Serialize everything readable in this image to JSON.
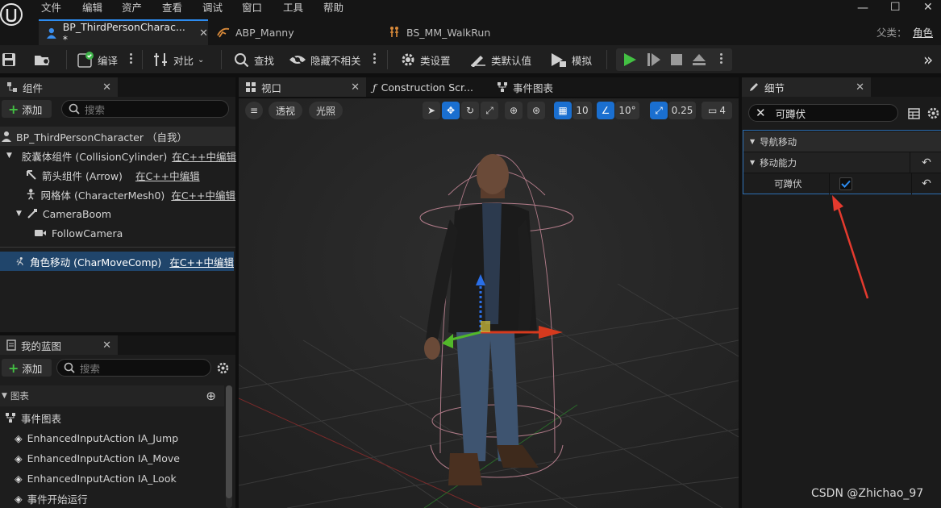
{
  "menu": [
    "文件",
    "编辑",
    "资产",
    "查看",
    "调试",
    "窗口",
    "工具",
    "帮助"
  ],
  "window_controls": {
    "minimize": "—",
    "maximize": "☐",
    "close": "✕"
  },
  "tabs": [
    {
      "label": "BP_ThirdPersonCharac... *",
      "close": "✕"
    },
    {
      "label": "ABP_Manny"
    },
    {
      "label": "BS_MM_WalkRun"
    }
  ],
  "parent": {
    "label": "父类：",
    "value": "角色"
  },
  "toolbar": {
    "compile": "编译",
    "diff": "对比",
    "find": "查找",
    "hide_unrelated": "隐藏不相关",
    "class_settings": "类设置",
    "class_defaults": "类默认值",
    "simulate": "模拟"
  },
  "components_panel": {
    "title": "组件",
    "close": "✕",
    "add": "添加",
    "search_placeholder": "搜索",
    "items": [
      {
        "label": "BP_ThirdPersonCharacter （自我）",
        "edit": ""
      },
      {
        "label": "胶囊体组件 (CollisionCylinder)",
        "edit": "在C++中编辑"
      },
      {
        "label": "箭头组件 (Arrow)",
        "edit": "在C++中编辑"
      },
      {
        "label": "网格体 (CharacterMesh0)",
        "edit": "在C++中编辑"
      },
      {
        "label": "CameraBoom",
        "edit": ""
      },
      {
        "label": "FollowCamera",
        "edit": ""
      },
      {
        "label": "角色移动 (CharMoveComp)",
        "edit": "在C++中编辑"
      }
    ]
  },
  "blueprint_panel": {
    "title": "我的蓝图",
    "close": "✕",
    "add": "添加",
    "search_placeholder": "搜索",
    "section": "图表",
    "event_graph": "事件图表",
    "events": [
      "EnhancedInputAction IA_Jump",
      "EnhancedInputAction IA_Move",
      "EnhancedInputAction IA_Look",
      "事件开始运行"
    ]
  },
  "viewport": {
    "tab": "视口",
    "close": "✕",
    "construction_tab": "Construction Scr...",
    "event_graph_tab": "事件图表",
    "perspective": "透视",
    "lit": "光照",
    "grid_snap": "10",
    "rot_snap": "10°",
    "scale_snap": "0.25",
    "camera_speed": "4"
  },
  "details_panel": {
    "title": "细节",
    "close": "✕",
    "search_value": "可蹲伏",
    "nav_section": "导航移动",
    "movement_section": "移动能力",
    "can_crouch_label": "可蹲伏",
    "can_crouch": true
  },
  "watermark": "CSDN @Zhichao_97",
  "colors": {
    "accent": "#2d8cf0",
    "play": "#43c043",
    "annotation": "#e53a2e"
  }
}
